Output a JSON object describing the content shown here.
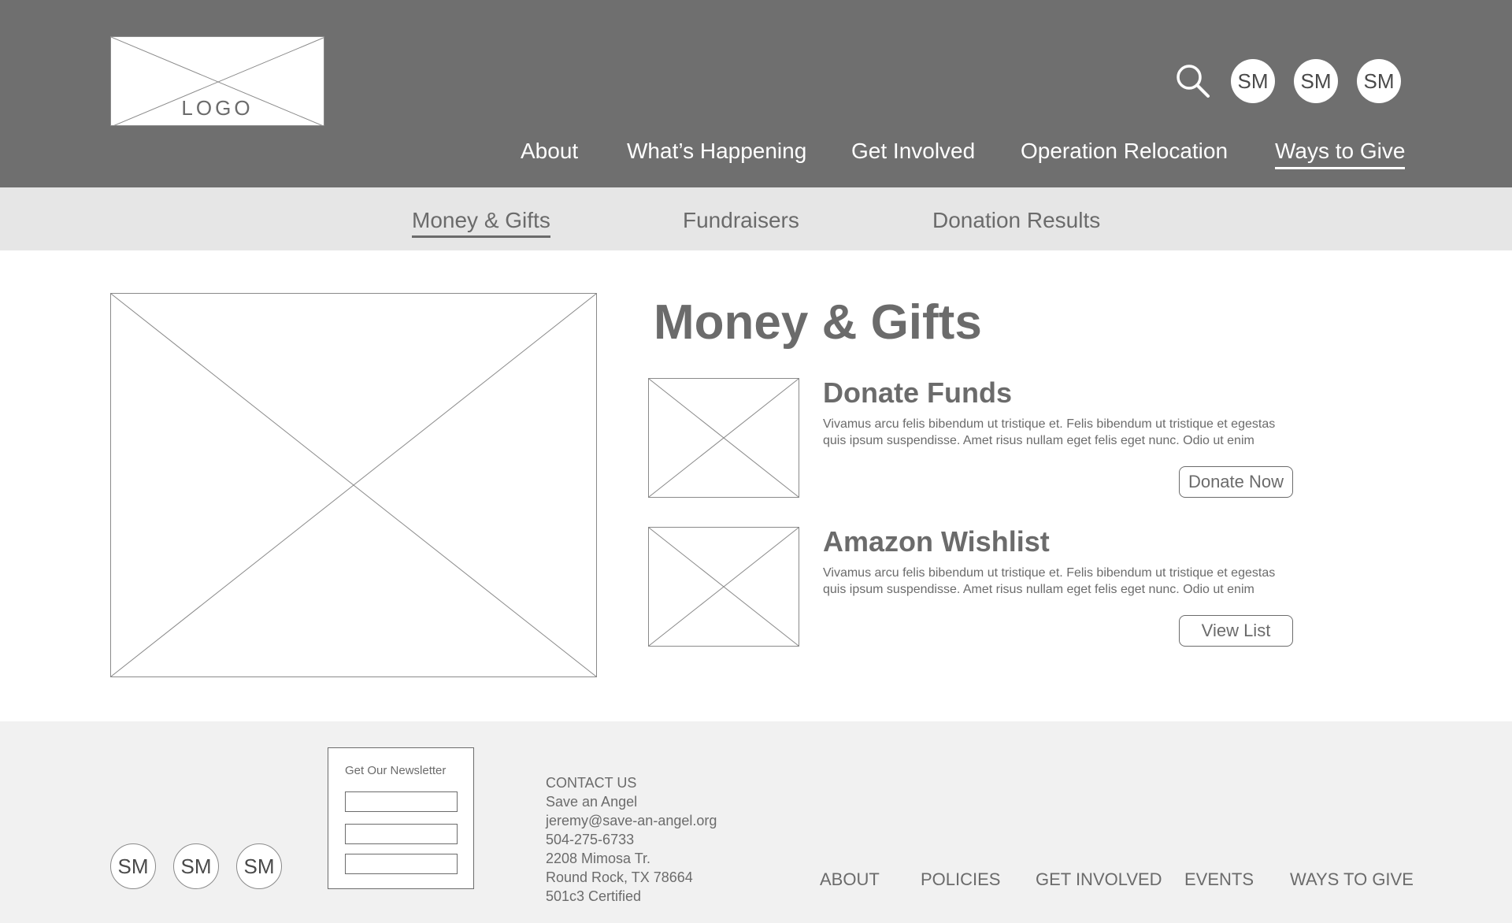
{
  "header": {
    "logo_text": "LOGO",
    "search_icon": "search-icon",
    "social": [
      "SM",
      "SM",
      "SM"
    ],
    "nav": [
      {
        "label": "About"
      },
      {
        "label": "What’s Happening"
      },
      {
        "label": "Get Involved"
      },
      {
        "label": "Operation Relocation"
      },
      {
        "label": "Ways to Give",
        "active": true
      }
    ]
  },
  "subnav": [
    {
      "label": "Money & Gifts",
      "active": true
    },
    {
      "label": "Fundraisers"
    },
    {
      "label": "Donation Results"
    }
  ],
  "main": {
    "title": "Money & Gifts",
    "items": [
      {
        "title": "Donate Funds",
        "description": "Vivamus arcu felis bibendum ut tristique et. Felis bibendum ut tristique et egestas quis ipsum suspendisse. Amet risus nullam eget felis eget nunc. Odio ut enim",
        "button": "Donate Now"
      },
      {
        "title": "Amazon Wishlist",
        "description": "Vivamus arcu felis bibendum ut tristique et. Felis bibendum ut tristique et egestas quis ipsum suspendisse. Amet risus nullam eget felis eget nunc. Odio ut enim",
        "button": "View List"
      }
    ]
  },
  "footer": {
    "social": [
      "SM",
      "SM",
      "SM"
    ],
    "newsletter_title": "Get Our Newsletter",
    "contact": {
      "heading": "CONTACT US",
      "org": "Save an Angel",
      "email": "jeremy@save-an-angel.org",
      "phone": "504-275-6733",
      "address1": "2208 Mimosa Tr.",
      "address2": "Round Rock, TX 78664",
      "status": "501c3 Certified"
    },
    "nav": [
      "ABOUT",
      "POLICIES",
      "GET INVOLVED",
      "EVENTS",
      "WAYS TO GIVE"
    ]
  },
  "colors": {
    "header_bg": "#6f6f6f",
    "subnav_bg": "#e6e6e6",
    "footer_bg": "#f1f1f1",
    "text": "#6b6b6b"
  }
}
